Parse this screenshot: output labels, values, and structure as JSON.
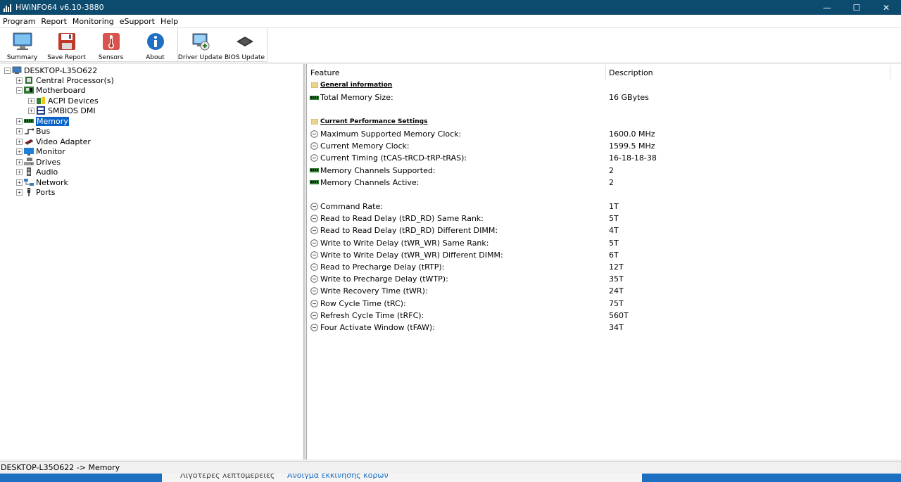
{
  "window": {
    "title": "HWiNFO64 v6.10-3880",
    "minimize": "—",
    "maximize": "☐",
    "close": "✕"
  },
  "menu": [
    "Program",
    "Report",
    "Monitoring",
    "eSupport",
    "Help"
  ],
  "toolbar": {
    "summary": "Summary",
    "save_report": "Save Report",
    "sensors": "Sensors",
    "about": "About",
    "driver_update": "Driver Update",
    "bios_update": "BIOS Update"
  },
  "tree": {
    "root": "DESKTOP-L35O622",
    "cpu": "Central Processor(s)",
    "motherboard": "Motherboard",
    "acpi": "ACPI Devices",
    "smbios": "SMBIOS DMI",
    "memory": "Memory",
    "bus": "Bus",
    "video": "Video Adapter",
    "monitor": "Monitor",
    "drives": "Drives",
    "audio": "Audio",
    "network": "Network",
    "ports": "Ports"
  },
  "details": {
    "header_feature": "Feature",
    "header_description": "Description",
    "general_section": "General information",
    "total_memory": {
      "label": "Total Memory Size:",
      "value": "16 GBytes"
    },
    "perf_section": "Current Performance Settings",
    "rows": [
      {
        "label": "Maximum Supported Memory Clock:",
        "value": "1600.0 MHz",
        "icon": "clock"
      },
      {
        "label": "Current Memory Clock:",
        "value": "1599.5 MHz",
        "icon": "clock"
      },
      {
        "label": "Current Timing (tCAS-tRCD-tRP-tRAS):",
        "value": "16-18-18-38",
        "icon": "clock"
      },
      {
        "label": "Memory Channels Supported:",
        "value": "2",
        "icon": "ram"
      },
      {
        "label": "Memory Channels Active:",
        "value": "2",
        "icon": "ram"
      }
    ],
    "timings": [
      {
        "label": "Command Rate:",
        "value": "1T"
      },
      {
        "label": "Read to Read Delay (tRD_RD) Same Rank:",
        "value": "5T"
      },
      {
        "label": "Read to Read Delay (tRD_RD) Different DIMM:",
        "value": "4T"
      },
      {
        "label": "Write to Write Delay (tWR_WR) Same Rank:",
        "value": "5T"
      },
      {
        "label": "Write to Write Delay (tWR_WR) Different DIMM:",
        "value": "6T"
      },
      {
        "label": "Read to Precharge Delay (tRTP):",
        "value": "12T"
      },
      {
        "label": "Write to Precharge Delay (tWTP):",
        "value": "35T"
      },
      {
        "label": "Write Recovery Time (tWR):",
        "value": "24T"
      },
      {
        "label": "Row Cycle Time (tRC):",
        "value": "75T"
      },
      {
        "label": "Refresh Cycle Time (tRFC):",
        "value": "560T"
      },
      {
        "label": "Four Activate Window (tFAW):",
        "value": "34T"
      }
    ]
  },
  "statusbar": {
    "text": "DESKTOP-L35O622 -> Memory"
  },
  "taskbar": {
    "item1": "Λιγότερες λεπτομέρειες",
    "item2": "Άνοιγμα εκκίνησης κορών"
  },
  "colors": {
    "titlebar": "#0c4a6e",
    "selection": "#0a64c8",
    "ram_icon": "#2e7d32",
    "taskbar": "#1d6fc1"
  }
}
